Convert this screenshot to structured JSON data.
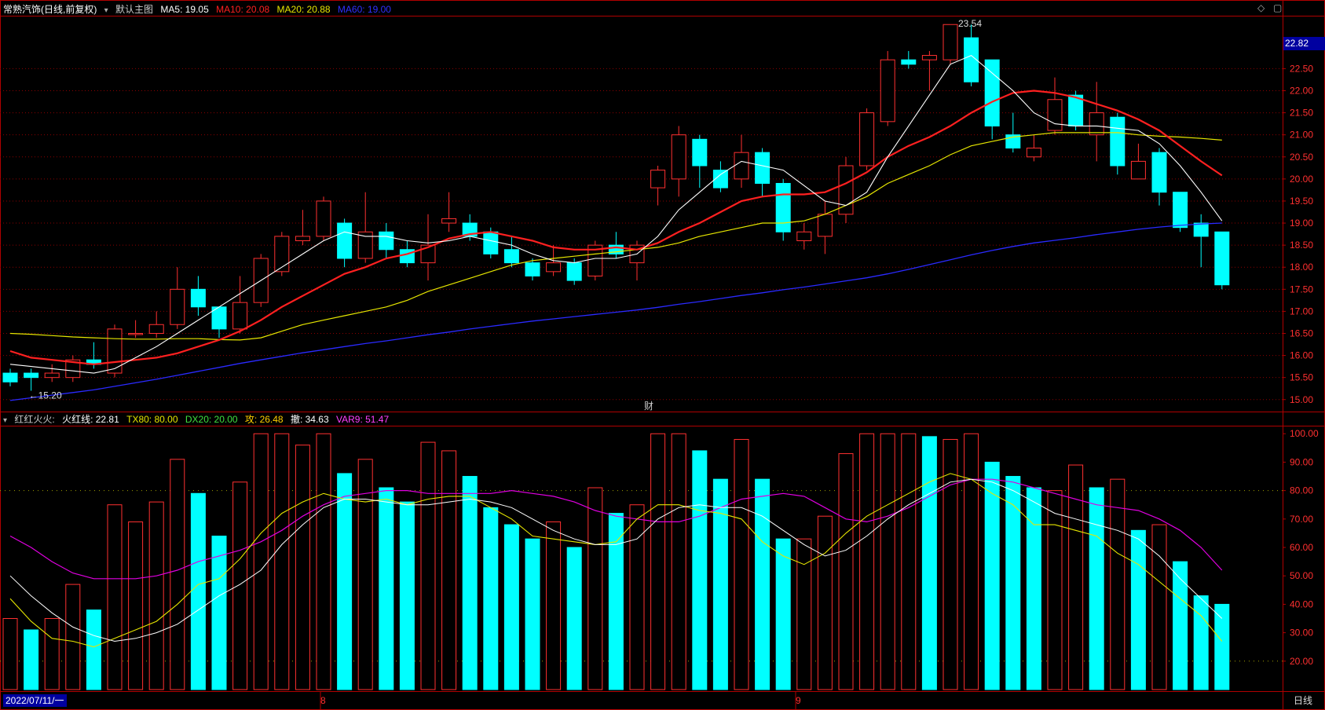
{
  "header": {
    "title": "常熟汽饰(日线,前复权)",
    "main_chart_label": "默认主图",
    "ma": [
      {
        "label": "MA5: 19.05",
        "color": "#ffffff"
      },
      {
        "label": "MA10: 20.08",
        "color": "#ff2020"
      },
      {
        "label": "MA20: 20.88",
        "color": "#e6e600"
      },
      {
        "label": "MA60: 19.00",
        "color": "#3030ff"
      }
    ]
  },
  "indicator_header": {
    "name": "红红火火:",
    "items": [
      {
        "label": "火红线: 22.81",
        "color": "#ffffff"
      },
      {
        "label": "TX80: 80.00",
        "color": "#e6e600"
      },
      {
        "label": "DX20: 20.00",
        "color": "#40e040"
      },
      {
        "label": "攻: 26.48",
        "color": "#ffd000"
      },
      {
        "label": "撤: 34.63",
        "color": "#ffffff"
      },
      {
        "label": "VAR9: 51.47",
        "color": "#ff40ff"
      }
    ]
  },
  "labels": {
    "high_mark": "23.54",
    "low_mark": "←15.20",
    "finance_mark": "财",
    "current_price": "22.82",
    "date_start": "2022/07/11/一",
    "month_8": "8",
    "month_9": "9",
    "period": "日线"
  },
  "colors": {
    "up": "#ff3030",
    "down": "#00ffff",
    "grid": "#8b0000",
    "axis": "#b00000"
  },
  "chart_data": [
    {
      "type": "candlestick",
      "title": "常熟汽饰(日线,前复权)",
      "ylim": [
        14.8,
        23.7
      ],
      "y_ticks": [
        15.0,
        15.5,
        16.0,
        16.5,
        17.0,
        17.5,
        18.0,
        18.5,
        19.0,
        19.5,
        20.0,
        20.5,
        21.0,
        21.5,
        22.0,
        22.5
      ],
      "candles": [
        [
          15.6,
          15.4,
          15.7,
          15.3
        ],
        [
          15.6,
          15.5,
          15.7,
          15.2
        ],
        [
          15.5,
          15.6,
          15.8,
          15.4
        ],
        [
          15.5,
          15.9,
          16.0,
          15.4
        ],
        [
          15.9,
          15.8,
          16.3,
          15.7
        ],
        [
          15.6,
          16.6,
          16.7,
          15.5
        ],
        [
          16.5,
          16.5,
          16.8,
          16.4
        ],
        [
          16.5,
          16.7,
          17.0,
          16.4
        ],
        [
          16.7,
          17.5,
          18.0,
          16.6
        ],
        [
          17.5,
          17.1,
          17.8,
          16.9
        ],
        [
          17.1,
          16.6,
          17.1,
          16.4
        ],
        [
          16.6,
          17.2,
          17.8,
          16.5
        ],
        [
          17.2,
          18.2,
          18.3,
          17.1
        ],
        [
          17.9,
          18.7,
          18.8,
          17.8
        ],
        [
          18.6,
          18.7,
          19.3,
          18.5
        ],
        [
          18.7,
          19.5,
          19.6,
          18.6
        ],
        [
          19.0,
          18.2,
          19.1,
          18.0
        ],
        [
          18.2,
          18.8,
          19.7,
          18.1
        ],
        [
          18.8,
          18.4,
          19.0,
          18.2
        ],
        [
          18.4,
          18.1,
          18.6,
          18.0
        ],
        [
          18.1,
          18.5,
          19.2,
          17.7
        ],
        [
          19.0,
          19.1,
          19.7,
          18.8
        ],
        [
          19.0,
          18.7,
          19.2,
          18.6
        ],
        [
          18.8,
          18.3,
          18.9,
          18.2
        ],
        [
          18.4,
          18.1,
          18.7,
          18.0
        ],
        [
          18.1,
          17.8,
          18.2,
          17.7
        ],
        [
          17.9,
          18.1,
          18.5,
          17.8
        ],
        [
          18.1,
          17.7,
          18.2,
          17.6
        ],
        [
          17.8,
          18.5,
          18.6,
          17.7
        ],
        [
          18.5,
          18.3,
          18.8,
          18.2
        ],
        [
          18.1,
          18.5,
          18.6,
          17.7
        ],
        [
          19.8,
          20.2,
          20.3,
          19.4
        ],
        [
          20.0,
          21.0,
          21.2,
          19.6
        ],
        [
          20.9,
          20.3,
          21.0,
          19.8
        ],
        [
          20.2,
          19.8,
          20.4,
          19.7
        ],
        [
          20.0,
          20.6,
          21.0,
          19.8
        ],
        [
          20.6,
          19.9,
          20.7,
          19.6
        ],
        [
          19.9,
          18.8,
          20.0,
          18.6
        ],
        [
          18.6,
          18.8,
          19.0,
          18.4
        ],
        [
          18.7,
          19.2,
          19.5,
          18.3
        ],
        [
          19.2,
          20.3,
          20.5,
          19.0
        ],
        [
          20.3,
          21.5,
          21.6,
          20.2
        ],
        [
          21.3,
          22.7,
          22.9,
          21.2
        ],
        [
          22.7,
          22.6,
          22.9,
          22.5
        ],
        [
          22.7,
          22.8,
          22.9,
          22.0
        ],
        [
          22.7,
          23.5,
          23.5,
          22.6
        ],
        [
          23.2,
          22.2,
          23.5,
          22.1
        ],
        [
          22.7,
          21.2,
          22.7,
          20.9
        ],
        [
          21.0,
          20.7,
          21.5,
          20.6
        ],
        [
          20.5,
          20.7,
          21.0,
          20.4
        ],
        [
          21.1,
          21.8,
          22.3,
          21.0
        ],
        [
          21.9,
          21.2,
          22.0,
          21.1
        ],
        [
          21.0,
          21.5,
          22.2,
          20.4
        ],
        [
          21.4,
          20.3,
          21.5,
          20.1
        ],
        [
          20.0,
          20.4,
          20.8,
          20.0
        ],
        [
          20.6,
          19.7,
          20.7,
          19.4
        ],
        [
          19.7,
          18.9,
          19.7,
          18.8
        ],
        [
          19.0,
          18.7,
          19.2,
          18.0
        ],
        [
          18.8,
          17.6,
          18.8,
          17.5
        ]
      ],
      "ma5": [
        15.8,
        15.75,
        15.7,
        15.65,
        15.6,
        15.7,
        15.95,
        16.2,
        16.5,
        16.8,
        17.1,
        17.4,
        17.7,
        18.0,
        18.3,
        18.6,
        18.8,
        18.7,
        18.7,
        18.6,
        18.55,
        18.6,
        18.7,
        18.6,
        18.5,
        18.3,
        18.15,
        18.1,
        18.2,
        18.2,
        18.3,
        18.7,
        19.3,
        19.7,
        20.1,
        20.4,
        20.3,
        20.2,
        19.85,
        19.5,
        19.4,
        19.7,
        20.5,
        21.2,
        21.9,
        22.6,
        22.8,
        22.4,
        22.0,
        21.5,
        21.25,
        21.2,
        21.2,
        21.15,
        21.1,
        20.8,
        20.3,
        19.7,
        19.05
      ],
      "ma10": [
        16.1,
        15.95,
        15.9,
        15.85,
        15.8,
        15.85,
        15.9,
        15.95,
        16.05,
        16.2,
        16.35,
        16.55,
        16.8,
        17.1,
        17.35,
        17.6,
        17.85,
        18.0,
        18.2,
        18.3,
        18.45,
        18.65,
        18.75,
        18.8,
        18.7,
        18.6,
        18.45,
        18.4,
        18.4,
        18.45,
        18.4,
        18.55,
        18.8,
        19.0,
        19.25,
        19.5,
        19.6,
        19.65,
        19.65,
        19.7,
        19.9,
        20.15,
        20.5,
        20.75,
        20.95,
        21.2,
        21.5,
        21.75,
        21.95,
        22.0,
        21.95,
        21.85,
        21.7,
        21.55,
        21.35,
        21.1,
        20.75,
        20.4,
        20.08
      ],
      "ma20": [
        16.5,
        16.48,
        16.45,
        16.42,
        16.4,
        16.38,
        16.37,
        16.37,
        16.38,
        16.38,
        16.36,
        16.35,
        16.4,
        16.55,
        16.7,
        16.8,
        16.9,
        17.0,
        17.1,
        17.25,
        17.45,
        17.6,
        17.75,
        17.9,
        18.05,
        18.15,
        18.2,
        18.25,
        18.3,
        18.35,
        18.4,
        18.45,
        18.55,
        18.7,
        18.8,
        18.9,
        19.0,
        19.0,
        19.05,
        19.2,
        19.4,
        19.6,
        19.9,
        20.1,
        20.3,
        20.55,
        20.75,
        20.85,
        20.95,
        21.0,
        21.05,
        21.05,
        21.05,
        21.05,
        21.0,
        20.97,
        20.95,
        20.92,
        20.88
      ],
      "ma60": [
        14.98,
        15.04,
        15.1,
        15.16,
        15.22,
        15.3,
        15.38,
        15.46,
        15.55,
        15.64,
        15.73,
        15.82,
        15.9,
        15.98,
        16.06,
        16.13,
        16.2,
        16.27,
        16.33,
        16.4,
        16.47,
        16.53,
        16.6,
        16.66,
        16.72,
        16.78,
        16.83,
        16.88,
        16.93,
        16.98,
        17.03,
        17.09,
        17.16,
        17.22,
        17.29,
        17.36,
        17.42,
        17.49,
        17.55,
        17.62,
        17.69,
        17.76,
        17.85,
        17.95,
        18.06,
        18.17,
        18.28,
        18.38,
        18.47,
        18.55,
        18.61,
        18.67,
        18.74,
        18.8,
        18.86,
        18.91,
        18.95,
        18.98,
        19.0
      ]
    },
    {
      "type": "bar",
      "title": "红红火火",
      "ylim": [
        10,
        102
      ],
      "y_ticks": [
        20.0,
        30.0,
        40.0,
        50.0,
        60.0,
        70.0,
        80.0,
        90.0,
        100.0
      ],
      "bars": [
        35,
        31,
        35,
        47,
        38,
        75,
        69,
        76,
        91,
        79,
        64,
        83,
        100,
        100,
        96,
        100,
        86,
        91,
        81,
        76,
        97,
        94,
        85,
        74,
        68,
        63,
        69,
        60,
        81,
        72,
        75,
        100,
        100,
        94,
        84,
        98,
        84,
        63,
        63,
        71,
        93,
        100,
        100,
        100,
        99,
        98,
        100,
        90,
        85,
        81,
        80,
        89,
        81,
        84,
        66,
        68,
        55,
        43,
        40
      ],
      "huohong_line": [
        50,
        43,
        37,
        32,
        29,
        27,
        28,
        30,
        33,
        38,
        43,
        47,
        52,
        61,
        68,
        74,
        77,
        77,
        76,
        75,
        75,
        76,
        77,
        76,
        74,
        70,
        66,
        63,
        61,
        61,
        63,
        70,
        74,
        75,
        74,
        74,
        71,
        66,
        61,
        57,
        59,
        64,
        70,
        75,
        79,
        83,
        84,
        83,
        80,
        76,
        72,
        70,
        68,
        66,
        63,
        57,
        49,
        42,
        35
      ],
      "gong_line": [
        42,
        34,
        28,
        27,
        25,
        28,
        31,
        34,
        40,
        47,
        49,
        56,
        65,
        72,
        76,
        79,
        77,
        76,
        77,
        75,
        77,
        78,
        78,
        74,
        70,
        64,
        63,
        62,
        61,
        62,
        70,
        75,
        75,
        73,
        72,
        70,
        62,
        57,
        54,
        58,
        65,
        71,
        75,
        79,
        83,
        86,
        84,
        79,
        75,
        68,
        68,
        66,
        64,
        58,
        54,
        48,
        42,
        36,
        27
      ],
      "var9_line": [
        64,
        60,
        55,
        51,
        49,
        49,
        49,
        50,
        52,
        55,
        57,
        59,
        62,
        66,
        71,
        75,
        78,
        79,
        80,
        80,
        79,
        79,
        79,
        79,
        80,
        79,
        78,
        76,
        73,
        71,
        70,
        69,
        69,
        71,
        74,
        77,
        78,
        79,
        78,
        74,
        70,
        69,
        71,
        74,
        78,
        82,
        84,
        84,
        83,
        81,
        79,
        77,
        75,
        74,
        73,
        70,
        66,
        60,
        52
      ],
      "tx80": 80.0,
      "dx20": 20.0
    }
  ]
}
